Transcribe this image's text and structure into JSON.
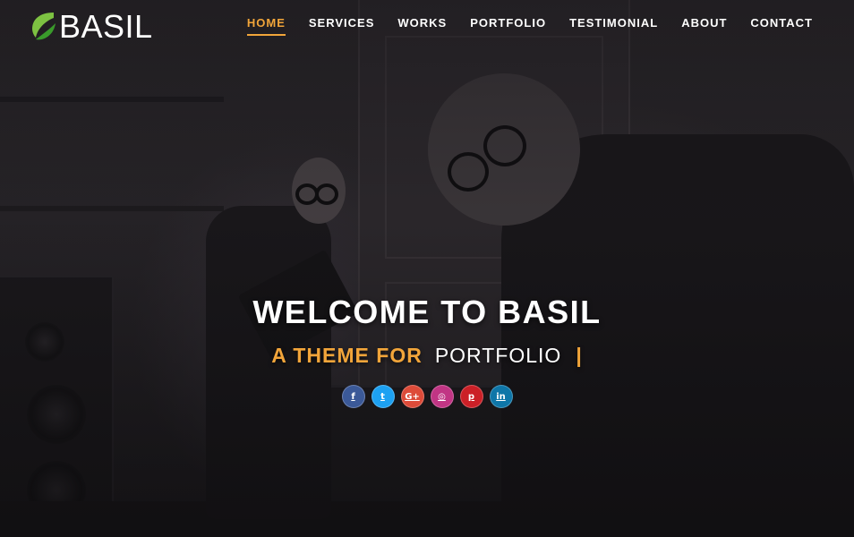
{
  "brand": {
    "name": "BASIL",
    "leaf_color_dark": "#3a9a2b",
    "leaf_color_light": "#7dc242"
  },
  "nav": {
    "items": [
      {
        "label": "HOME",
        "active": true
      },
      {
        "label": "SERVICES",
        "active": false
      },
      {
        "label": "WORKS",
        "active": false
      },
      {
        "label": "PORTFOLIO",
        "active": false
      },
      {
        "label": "TESTIMONIAL",
        "active": false
      },
      {
        "label": "ABOUT",
        "active": false
      },
      {
        "label": "CONTACT",
        "active": false
      }
    ],
    "accent_color": "#f2a53a"
  },
  "hero": {
    "title": "WELCOME TO BASIL",
    "subtitle_accent": "A THEME FOR",
    "subtitle_word": "PORTFOLIO",
    "cursor": "|"
  },
  "socials": [
    {
      "name": "facebook-icon",
      "glyph": "f",
      "color": "#3b5998"
    },
    {
      "name": "twitter-icon",
      "glyph": "t",
      "color": "#1da1f2"
    },
    {
      "name": "google-plus-icon",
      "glyph": "G+",
      "color": "#dd4b39"
    },
    {
      "name": "instagram-icon",
      "glyph": "◎",
      "color": "#c13584"
    },
    {
      "name": "pinterest-icon",
      "glyph": "p",
      "color": "#cb2027"
    },
    {
      "name": "linkedin-icon",
      "glyph": "in",
      "color": "#0e76a8"
    }
  ]
}
